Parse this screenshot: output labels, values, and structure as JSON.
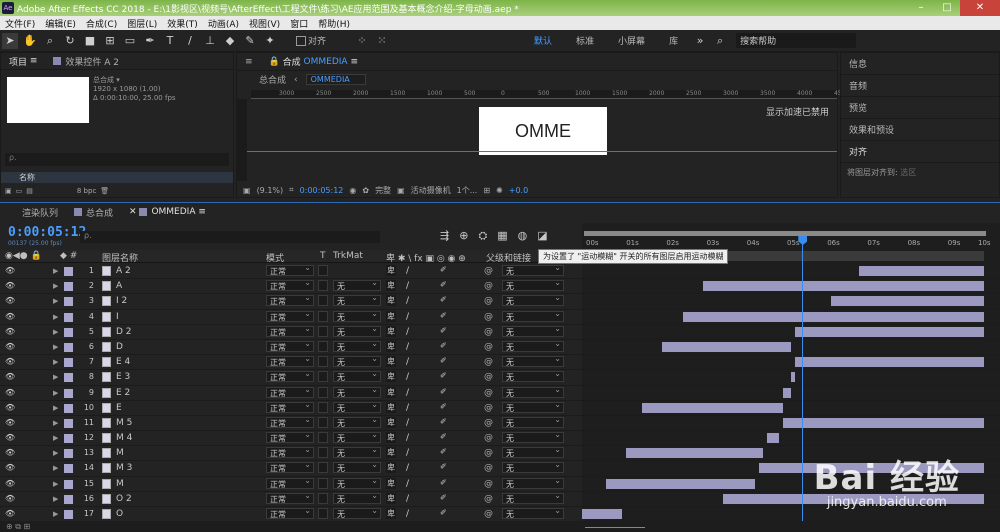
{
  "window": {
    "title": "Adobe After Effects CC 2018 - E:\\1影视区\\视频号\\AfterEffect\\工程文件\\练习\\AE应用范围及基本概念介绍-字母动画.aep *",
    "app_icon": "Ae"
  },
  "menu": [
    "文件(F)",
    "编辑(E)",
    "合成(C)",
    "图层(L)",
    "效果(T)",
    "动画(A)",
    "视图(V)",
    "窗口",
    "帮助(H)"
  ],
  "toolbar": {
    "align_label": "对齐",
    "workspaces": [
      "默认",
      "标准",
      "小屏幕",
      "库"
    ],
    "active_workspace": "默认",
    "search_placeholder": "搜索帮助"
  },
  "project": {
    "tab_label": "项目",
    "effects_tab": "效果控件 A 2",
    "comp_name": "总合成 ▾",
    "info_line1": "1920 x 1080 (1.00)",
    "info_line2": "Δ 0:00:10:00, 25.00 fps",
    "name_col": "名称",
    "bpc": "8 bpc"
  },
  "viewer": {
    "tab_label": "合成",
    "comp_tab": "OMMEDIA",
    "crumb_parent": "总合成",
    "crumb_child": "OMMEDIA",
    "frame_text": "OMME",
    "gpu_note": "显示加速已禁用",
    "zoom": "(9.1%)",
    "timecode": "0:00:05:12",
    "quality": "完整",
    "camera": "活动摄像机",
    "views": "1个...",
    "exposure": "+0.0",
    "ruler_ticks": [
      "3000",
      "2500",
      "2000",
      "1500",
      "1000",
      "500",
      "0",
      "500",
      "1000",
      "1500",
      "2000",
      "2500",
      "3000",
      "3500",
      "4000",
      "4500"
    ]
  },
  "right_panel": {
    "items": [
      "信息",
      "音频",
      "预览",
      "效果和预设",
      "对齐"
    ],
    "align_to_label": "将图层对齐到:",
    "align_to_value": "选区"
  },
  "timeline": {
    "tabs": [
      "渲染队列",
      "总合成",
      "OMMEDIA"
    ],
    "active_tab": "OMMEDIA",
    "current_time": "0:00:05:12",
    "fps_note": "00137 (25.00 fps)",
    "search_placeholder": "ρ.",
    "tooltip": "为设置了 \"运动模糊\" 开关的所有图层启用运动模糊",
    "headers": {
      "layer_name": "图层名称",
      "mode": "模式",
      "t": "T",
      "trkmat": "TrkMat",
      "parent": "父级和链接"
    },
    "ruler": [
      "00s",
      "01s",
      "02s",
      "03s",
      "04s",
      "05s",
      "06s",
      "07s",
      "08s",
      "09s",
      "10s"
    ],
    "layers": [
      {
        "num": "1",
        "name": "A 2",
        "mode": "正常",
        "trk": "",
        "parent": "无",
        "bar_start": 6.9,
        "bar_end": 10
      },
      {
        "num": "2",
        "name": "A",
        "mode": "正常",
        "trk": "无",
        "parent": "无",
        "bar_start": 3.0,
        "bar_end": 10
      },
      {
        "num": "3",
        "name": "I 2",
        "mode": "正常",
        "trk": "无",
        "parent": "无",
        "bar_start": 6.2,
        "bar_end": 10
      },
      {
        "num": "4",
        "name": "I",
        "mode": "正常",
        "trk": "无",
        "parent": "无",
        "bar_start": 2.5,
        "bar_end": 10
      },
      {
        "num": "5",
        "name": "D 2",
        "mode": "正常",
        "trk": "无",
        "parent": "无",
        "bar_start": 5.3,
        "bar_end": 10
      },
      {
        "num": "6",
        "name": "D",
        "mode": "正常",
        "trk": "无",
        "parent": "无",
        "bar_start": 2.0,
        "bar_end": 5.2
      },
      {
        "num": "7",
        "name": "E 4",
        "mode": "正常",
        "trk": "无",
        "parent": "无",
        "bar_start": 5.3,
        "bar_end": 10
      },
      {
        "num": "8",
        "name": "E 3",
        "mode": "正常",
        "trk": "无",
        "parent": "无",
        "bar_start": 5.2,
        "bar_end": 5.3
      },
      {
        "num": "9",
        "name": "E 2",
        "mode": "正常",
        "trk": "无",
        "parent": "无",
        "bar_start": 5.0,
        "bar_end": 5.2
      },
      {
        "num": "10",
        "name": "E",
        "mode": "正常",
        "trk": "无",
        "parent": "无",
        "bar_start": 1.5,
        "bar_end": 5.0
      },
      {
        "num": "11",
        "name": "M 5",
        "mode": "正常",
        "trk": "无",
        "parent": "无",
        "bar_start": 5.0,
        "bar_end": 10
      },
      {
        "num": "12",
        "name": "M 4",
        "mode": "正常",
        "trk": "无",
        "parent": "无",
        "bar_start": 4.6,
        "bar_end": 4.9
      },
      {
        "num": "13",
        "name": "M",
        "mode": "正常",
        "trk": "无",
        "parent": "无",
        "bar_start": 1.1,
        "bar_end": 4.5
      },
      {
        "num": "14",
        "name": "M 3",
        "mode": "正常",
        "trk": "无",
        "parent": "无",
        "bar_start": 4.4,
        "bar_end": 10
      },
      {
        "num": "15",
        "name": "M",
        "mode": "正常",
        "trk": "无",
        "parent": "无",
        "bar_start": 0.6,
        "bar_end": 4.3
      },
      {
        "num": "16",
        "name": "O 2",
        "mode": "正常",
        "trk": "无",
        "parent": "无",
        "bar_start": 3.5,
        "bar_end": 10
      },
      {
        "num": "17",
        "name": "O",
        "mode": "正常",
        "trk": "无",
        "parent": "无",
        "bar_start": 0.0,
        "bar_end": 1.0
      }
    ],
    "playhead_seconds": 5.48
  },
  "watermark": {
    "big": "Bai 经验",
    "small": "jingyan.baidu.com"
  },
  "colors": {
    "accent": "#4b9dff",
    "layer_bar": "#9c99c0",
    "label": "#aaa7cf",
    "playhead": "#3a8df0"
  }
}
